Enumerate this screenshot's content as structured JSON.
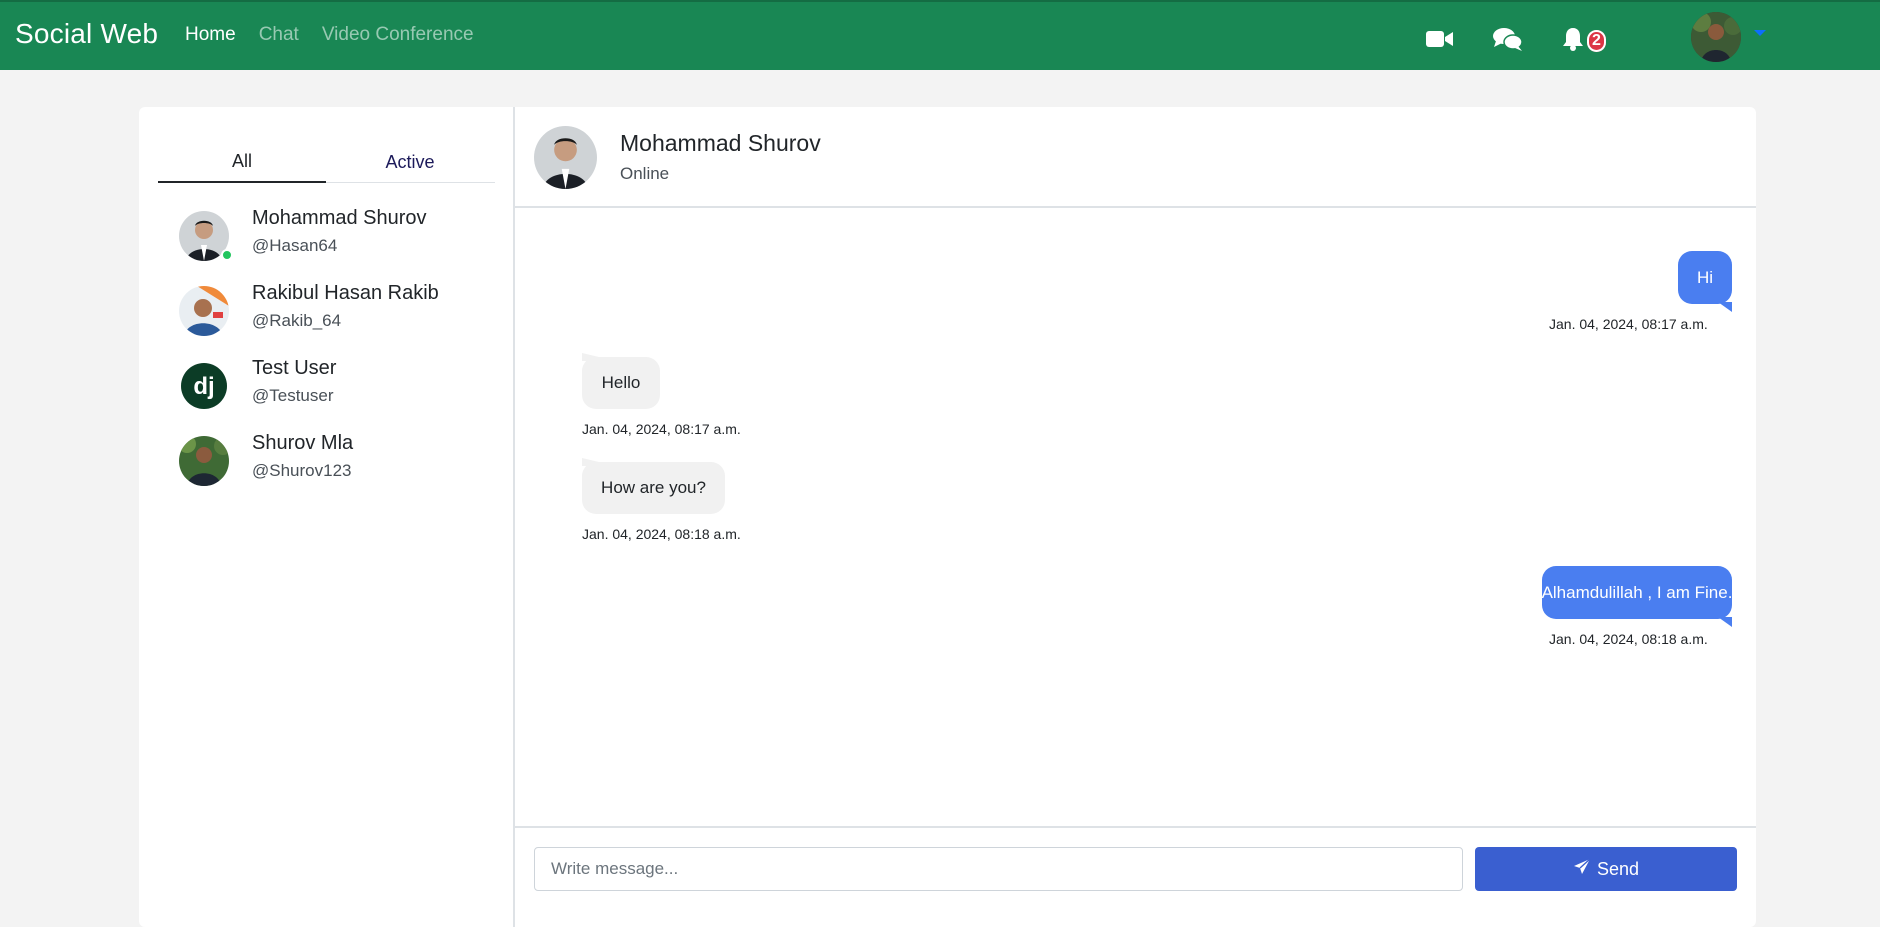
{
  "navbar": {
    "brand": "Social Web",
    "links": [
      {
        "label": "Home",
        "active": true
      },
      {
        "label": "Chat",
        "active": false
      },
      {
        "label": "Video Conference",
        "active": false
      }
    ],
    "icons": [
      "video-camera-icon",
      "chat-bubbles-icon",
      "bell-icon"
    ],
    "notification_count": "2",
    "accent_color": "#198754"
  },
  "sidebar": {
    "tabs": [
      {
        "label": "All",
        "active": true
      },
      {
        "label": "Active",
        "active": false
      }
    ],
    "contacts": [
      {
        "name": "Mohammad Shurov",
        "handle": "@Hasan64",
        "online": true
      },
      {
        "name": "Rakibul Hasan Rakib",
        "handle": "@Rakib_64",
        "online": false
      },
      {
        "name": "Test User",
        "handle": "@Testuser",
        "online": false,
        "avatar_text": "dj"
      },
      {
        "name": "Shurov Mla",
        "handle": "@Shurov123",
        "online": false
      }
    ]
  },
  "chat": {
    "header": {
      "name": "Mohammad Shurov",
      "status": "Online"
    },
    "messages": [
      {
        "direction": "out",
        "text": "Hi",
        "time": "Jan. 04, 2024, 08:17 a.m."
      },
      {
        "direction": "in",
        "text": "Hello",
        "time": "Jan. 04, 2024, 08:17 a.m."
      },
      {
        "direction": "in",
        "text": "How are you?",
        "time": "Jan. 04, 2024, 08:18 a.m."
      },
      {
        "direction": "out",
        "text": "Alhamdulillah , I am Fine.",
        "time": "Jan. 04, 2024, 08:18 a.m."
      }
    ],
    "composer": {
      "placeholder": "Write message...",
      "value": "",
      "send_label": "Send"
    }
  }
}
